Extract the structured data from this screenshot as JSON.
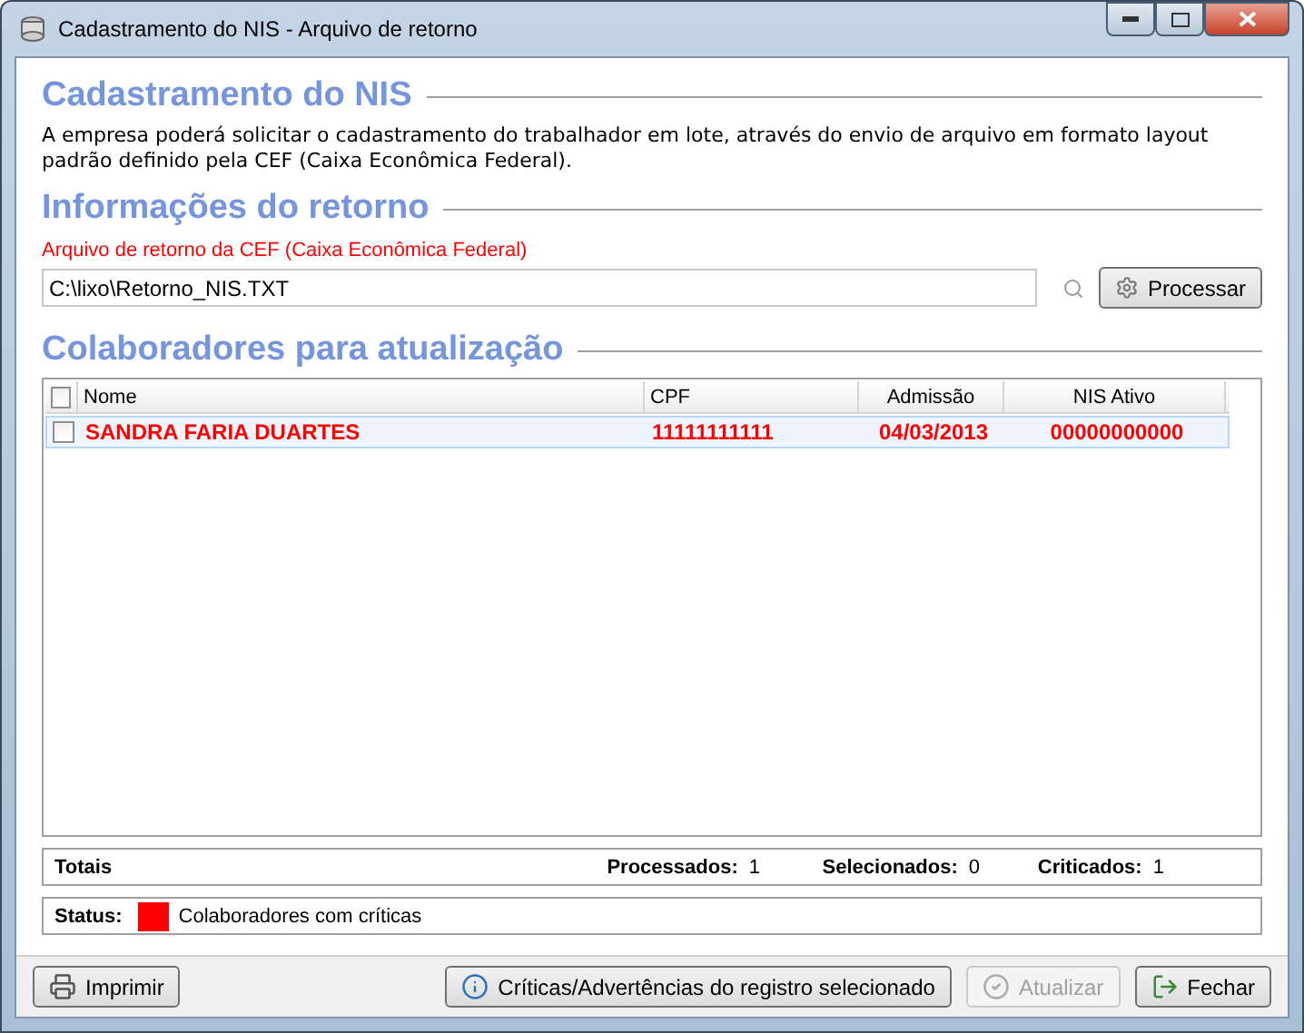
{
  "window": {
    "title": "Cadastramento do NIS - Arquivo de retorno"
  },
  "intro": {
    "heading": "Cadastramento do NIS",
    "text": "A empresa poderá solicitar o cadastramento do trabalhador em lote, através do envio de arquivo em formato layout padrão definido pela CEF (Caixa Econômica Federal)."
  },
  "return_info": {
    "heading": "Informações do retorno",
    "field_label": "Arquivo de retorno da CEF (Caixa Econômica Federal)",
    "file_path": "C:\\lixo\\Retorno_NIS.TXT",
    "process_button": "Processar"
  },
  "employees": {
    "heading": "Colaboradores para atualização",
    "table": {
      "all_checked": false,
      "columns": [
        "Nome",
        "CPF",
        "Admissão",
        "NIS Ativo"
      ],
      "rows": [
        {
          "checked": false,
          "selected": true,
          "color": "#ff0000",
          "cells": [
            "SANDRA FARIA DUARTES",
            "11111111111",
            "04/03/2013",
            "00000000000"
          ]
        }
      ]
    }
  },
  "totals": {
    "label": "Totais",
    "items": [
      {
        "label": "Processados:",
        "value": "1"
      },
      {
        "label": "Selecionados:",
        "value": "0"
      },
      {
        "label": "Criticados:",
        "value": "1"
      }
    ]
  },
  "status": {
    "label": "Status:",
    "legend": [
      {
        "color": "#ff0000",
        "text": "Colaboradores com críticas"
      }
    ]
  },
  "buttons": [
    {
      "kind": "print",
      "label": "Imprimir",
      "disabled": false
    },
    {
      "kind": "info",
      "label": "Críticas/Advertências do registro selecionado",
      "disabled": false
    },
    {
      "kind": "update",
      "label": "Atualizar",
      "disabled": true
    },
    {
      "kind": "close",
      "label": "Fechar",
      "disabled": false
    }
  ]
}
